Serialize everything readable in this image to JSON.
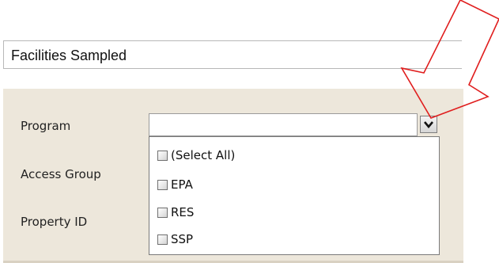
{
  "header": {
    "title": "Facilities Sampled"
  },
  "form": {
    "program_label": "Program",
    "program_value": "",
    "access_group_label": "Access Group",
    "access_group_value": "",
    "property_id_label": "Property ID",
    "property_id_value": ""
  },
  "dropdown": {
    "options": [
      {
        "label": "(Select All)",
        "checked": false
      },
      {
        "label": "EPA",
        "checked": false
      },
      {
        "label": "RES",
        "checked": false
      },
      {
        "label": "SSP",
        "checked": false
      }
    ]
  },
  "annotation": {
    "arrow_color": "#e01e1e"
  },
  "icons": {
    "dropdown": "chevron-down-icon",
    "annotation": "red-arrow-icon"
  }
}
